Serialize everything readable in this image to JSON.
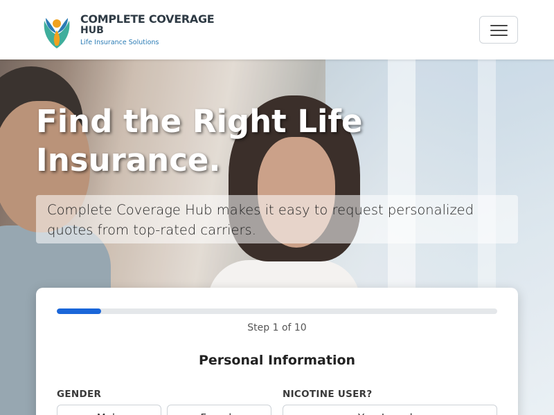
{
  "brand": {
    "name_line1": "COMPLETE COVERAGE",
    "name_line2": "HUB",
    "tagline": "Life Insurance Solutions",
    "colors": {
      "dark": "#2f3b45",
      "blue": "#2b7cb5",
      "orange": "#f0a21f",
      "teal": "#3fae9c"
    }
  },
  "navbar": {
    "toggle_icon": "hamburger-menu-icon"
  },
  "hero": {
    "headline": "Find the Right Life Insurance.",
    "lead": "Complete Coverage Hub makes it easy to request personalized quotes from top-rated carriers."
  },
  "form": {
    "progress": {
      "current_step": 1,
      "total_steps": 10,
      "percent": 10
    },
    "step_text": "Step 1 of 10",
    "section_title": "Personal Information",
    "gender": {
      "label": "GENDER",
      "options": [
        "Male",
        "Female"
      ]
    },
    "nicotine": {
      "label": "NICOTINE USER?",
      "options": [
        "Yes, I smoke"
      ]
    },
    "accent_color": "#1a66d9"
  }
}
